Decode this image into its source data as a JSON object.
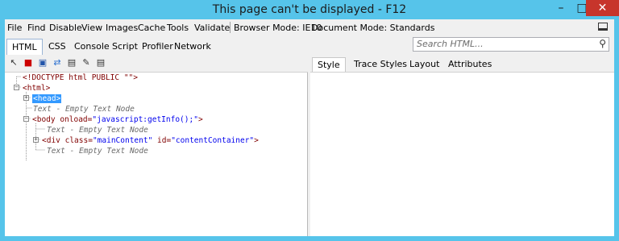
{
  "window": {
    "title": "This page can't be displayed - F12"
  },
  "menubar": {
    "items": [
      "File",
      "Find",
      "Disable",
      "View",
      "Images",
      "Cache",
      "Tools",
      "Validate"
    ],
    "browser_mode": "Browser Mode: IE10",
    "document_mode": "Document Mode: Standards"
  },
  "tabs": [
    "HTML",
    "CSS",
    "Console",
    "Script",
    "Profiler",
    "Network"
  ],
  "search": {
    "placeholder": "Search HTML..."
  },
  "toolbar": {
    "icons": [
      "select-element-icon",
      "clear-outline-icon",
      "save-icon",
      "refresh-icon",
      "word-wrap-icon",
      "edit-icon",
      "attributes-icon"
    ]
  },
  "tree": {
    "doctype": "<!DOCTYPE html PUBLIC \"\">",
    "html_open": "<html>",
    "head": "<head>",
    "text1": "Text - Empty Text Node",
    "body_tag": "<body ",
    "body_attr": "onload=",
    "body_val": "\"javascript:getInfo();\"",
    "body_close": ">",
    "text2": "Text - Empty Text Node",
    "div_tag": "<div ",
    "div_attr1": "class=",
    "div_val1": "\"mainContent\"",
    "div_attr2": " id=",
    "div_val2": "\"contentContainer\"",
    "div_close": ">",
    "text3": "Text - Empty Text Node"
  },
  "right_tabs": [
    "Style",
    "Trace Styles",
    "Layout",
    "Attributes"
  ],
  "colors": {
    "accent": "#56c4ea",
    "selection": "#3399ff",
    "close": "#c7352b"
  }
}
